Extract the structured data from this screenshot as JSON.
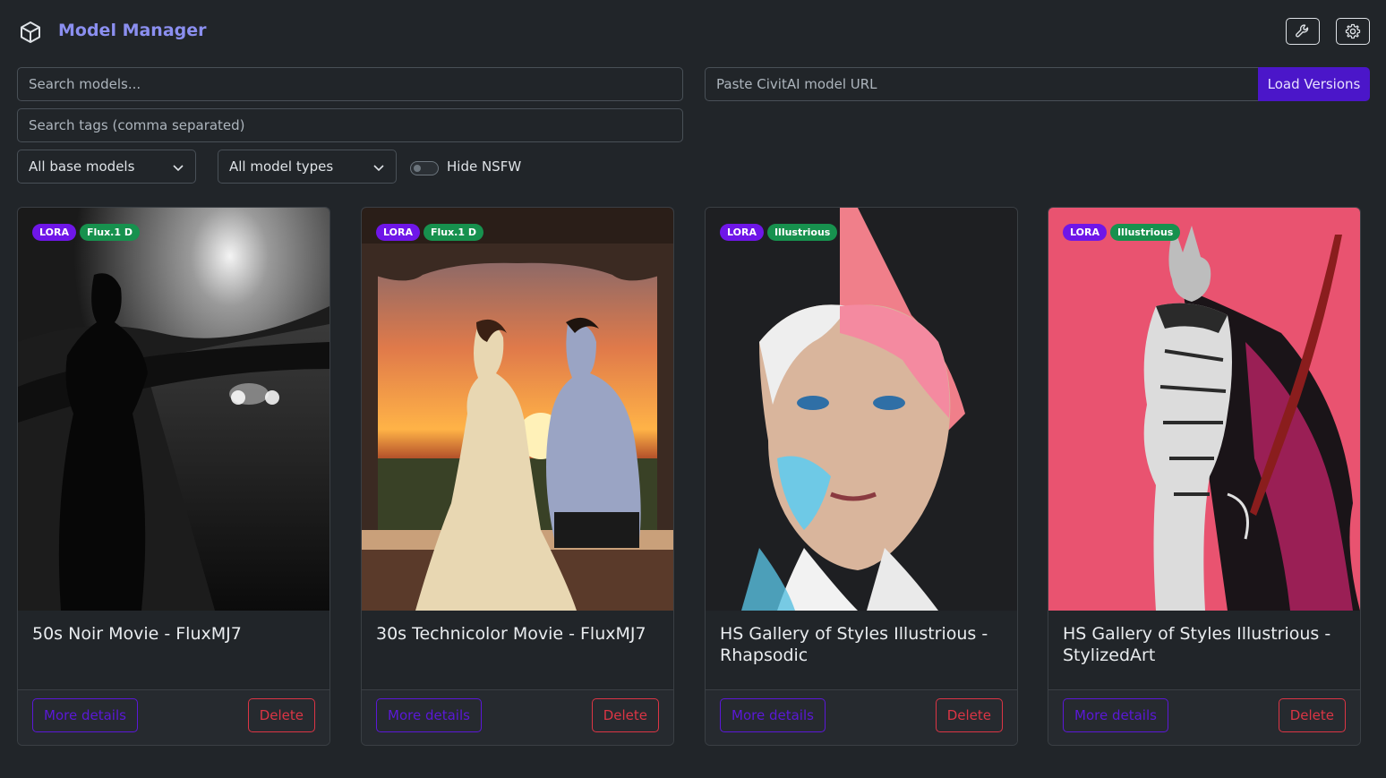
{
  "header": {
    "title": "Model Manager",
    "logo_icon": "cube-icon",
    "tools_icon": "wrench-icon",
    "settings_icon": "gear-icon"
  },
  "search": {
    "models_placeholder": "Search models...",
    "tags_placeholder": "Search tags (comma separated)",
    "url_placeholder": "Paste CivitAI model URL",
    "load_label": "Load Versions"
  },
  "filters": {
    "base_models": "All base models",
    "model_types": "All model types",
    "nsfw_label": "Hide NSFW",
    "nsfw_enabled": false
  },
  "colors": {
    "accent": "#8b8ff0",
    "load_button": "#4b16c9",
    "badge_type": "#6f16e8",
    "badge_base": "#17914e",
    "delete": "#dc3545"
  },
  "cards": [
    {
      "type": "LORA",
      "base": "Flux.1 D",
      "title": "50s Noir Movie - FluxMJ7",
      "details_label": "More details",
      "delete_label": "Delete"
    },
    {
      "type": "LORA",
      "base": "Flux.1 D",
      "title": "30s Technicolor Movie - FluxMJ7",
      "details_label": "More details",
      "delete_label": "Delete"
    },
    {
      "type": "LORA",
      "base": "Illustrious",
      "title": "HS Gallery of Styles Illustrious - Rhapsodic",
      "details_label": "More details",
      "delete_label": "Delete"
    },
    {
      "type": "LORA",
      "base": "Illustrious",
      "title": "HS Gallery of Styles Illustrious - StylizedArt",
      "details_label": "More details",
      "delete_label": "Delete"
    }
  ]
}
